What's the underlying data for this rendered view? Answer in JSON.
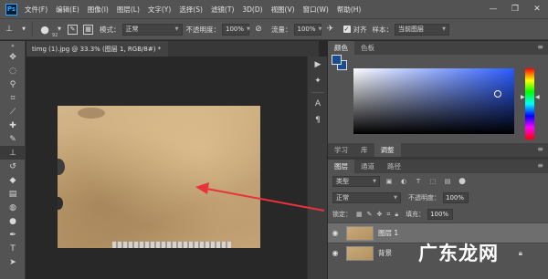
{
  "app": {
    "logo": "Ps"
  },
  "menu": [
    "文件(F)",
    "编辑(E)",
    "图像(I)",
    "图层(L)",
    "文字(Y)",
    "选择(S)",
    "滤镜(T)",
    "3D(D)",
    "视图(V)",
    "窗口(W)",
    "帮助(H)"
  ],
  "window_controls": {
    "minimize": "—",
    "maximize": "❐",
    "close": "✕"
  },
  "options": {
    "brush_size": "92",
    "mode_label": "模式：",
    "mode_value": "正常",
    "opacity_label": "不透明度：",
    "opacity_value": "100%",
    "flow_label": "流量：",
    "flow_value": "100%",
    "align_label": "对齐",
    "sample_label": "样本：",
    "sample_value": "当前图层"
  },
  "document": {
    "tab_title": "timg (1).jpg @ 33.3% (图层 1, RGB/8#) *"
  },
  "color_panel": {
    "tabs": [
      "颜色",
      "色板"
    ],
    "foreground": "#1a4d8f",
    "background": "#1a4d8f",
    "field_hue": "#2a5cff"
  },
  "adjust_tabs": [
    "学习",
    "库",
    "调整"
  ],
  "layers_panel": {
    "tabs": [
      "图层",
      "通道",
      "路径"
    ],
    "filter_value": "类型",
    "blend_value": "正常",
    "opacity_label": "不透明度：",
    "opacity_value": "100%",
    "lock_label": "锁定：",
    "fill_label": "填充：",
    "fill_value": "100%",
    "layers": [
      {
        "name": "图层 1",
        "selected": true
      },
      {
        "name": "背景",
        "selected": false
      }
    ]
  },
  "watermark": "广东龙网",
  "colors": {
    "ui_dark": "#535353",
    "canvas_bg": "#282828",
    "arrow": "#e8323c"
  }
}
